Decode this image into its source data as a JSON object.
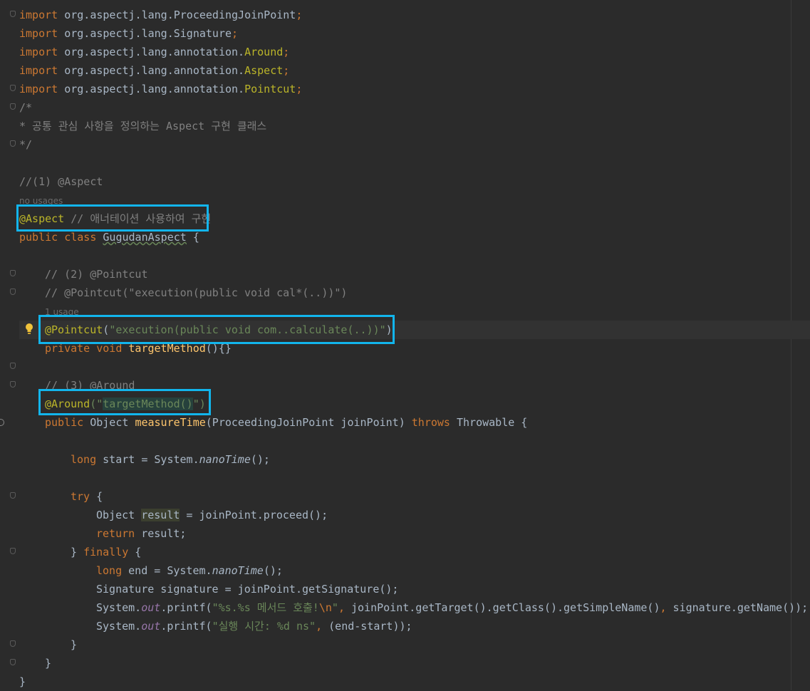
{
  "code": {
    "imports": {
      "kw": "import",
      "pkg_lang": "org.aspectj.lang.",
      "pkg_annotation": "org.aspectj.lang.annotation.",
      "proceeding": "ProceedingJoinPoint",
      "signature": "Signature",
      "around": "Around",
      "aspect": "Aspect",
      "pointcut": "Pointcut",
      "semi": ";"
    },
    "doc_open": "/*",
    "doc_body": "* 공통 관심 사항을 정의하는 Aspect 구현 클래스",
    "doc_close": "*/",
    "c1": "//(1) @Aspect",
    "no_usages": "no usages",
    "aspect_ann": "@Aspect",
    "aspect_comment": " // 애너테이션 사용하여 구현",
    "class_kw": "public class ",
    "class_name": "GugudanAspect",
    "class_open": " {",
    "c2": "// (2) @Pointcut",
    "c2b": "// @Pointcut(\"execution(public void cal*(..))\")",
    "one_usage": "1 usage",
    "pc_ann": "@Pointcut",
    "pc_open": "(",
    "pc_str": "\"execution(public void com..calculate(..))\"",
    "pc_close": ")",
    "pm_kw": "private void ",
    "pm_name": "targetMethod",
    "pm_rest": "(){}",
    "c3": "// (3) @Around",
    "ar_ann": "@Around",
    "ar_open": "(\"",
    "ar_inner": "targetMethod()",
    "ar_close": "\")",
    "mt_kw": "public ",
    "mt_type": "Object ",
    "mt_name": "measureTime",
    "mt_params": "(ProceedingJoinPoint joinPoint) ",
    "mt_throws": "throws",
    "mt_tail": " Throwable {",
    "long_kw": "long",
    "start_assign": " start = System.",
    "nano": "nanoTime",
    "call_end": "();",
    "try_kw": "try",
    "brace_open": " {",
    "obj_type": "Object ",
    "result_var": "result",
    "proceed": " = joinPoint.proceed();",
    "return_kw": "return",
    "return_rest": " result;",
    "close_brace_sp": "} ",
    "finally_kw": "finally",
    "end_assign": " end = System.",
    "sig_line": "Signature signature = joinPoint.getSignature();",
    "sys": "System.",
    "out": "out",
    "printf_open": ".printf(",
    "fmt1_a": "\"%s.%s 메서드 호출!",
    "fmt1_esc": "\\n",
    "fmt1_b": "\"",
    "comma": ", ",
    "pf1_args": "joinPoint.getTarget().getClass().getSimpleName()",
    "pf1_sig": "signature.getName());",
    "fmt2": "\"실행 시간: %d ns\"",
    "pf2_args": "(end-start));",
    "rbrace": "}"
  },
  "colors": {
    "keyword": "#cc7832",
    "annotation": "#bbb529",
    "string": "#6a8759",
    "comment": "#808080",
    "method": "#ffc66d",
    "highlight_box": "#12b5ec"
  }
}
